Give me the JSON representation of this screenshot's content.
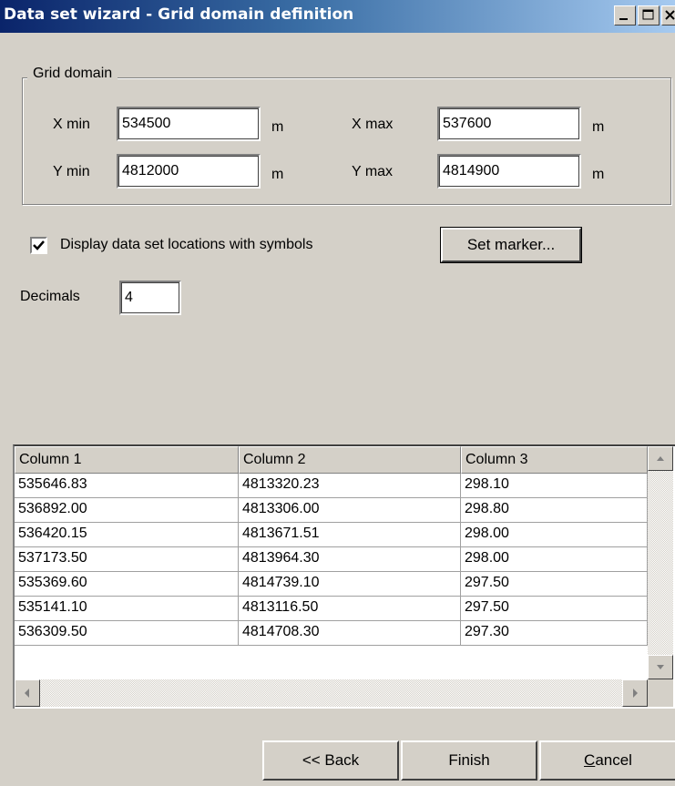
{
  "window": {
    "title": "Data set wizard - Grid domain definition"
  },
  "grid_domain": {
    "legend": "Grid domain",
    "xmin_label": "X min",
    "xmin_value": "534500",
    "xmin_unit": "m",
    "xmax_label": "X max",
    "xmax_value": "537600",
    "xmax_unit": "m",
    "ymin_label": "Y min",
    "ymin_value": "4812000",
    "ymin_unit": "m",
    "ymax_label": "Y max",
    "ymax_value": "4814900",
    "ymax_unit": "m"
  },
  "options": {
    "display_symbols_label": "Display data set locations with symbols",
    "display_symbols_checked": true,
    "set_marker_label": "Set marker...",
    "decimals_label": "Decimals",
    "decimals_value": "4"
  },
  "table": {
    "columns": [
      "Column 1",
      "Column 2",
      "Column 3"
    ],
    "rows": [
      [
        "535646.83",
        "4813320.23",
        "298.10"
      ],
      [
        "536892.00",
        "4813306.00",
        "298.80"
      ],
      [
        "536420.15",
        "4813671.51",
        "298.00"
      ],
      [
        "537173.50",
        "4813964.30",
        "298.00"
      ],
      [
        "535369.60",
        "4814739.10",
        "297.50"
      ],
      [
        "535141.10",
        "4813116.50",
        "297.50"
      ],
      [
        "536309.50",
        "4814708.30",
        "297.30"
      ]
    ]
  },
  "footer": {
    "back_label": "<< Back",
    "finish_label": "Finish",
    "cancel_label": "Cancel"
  }
}
